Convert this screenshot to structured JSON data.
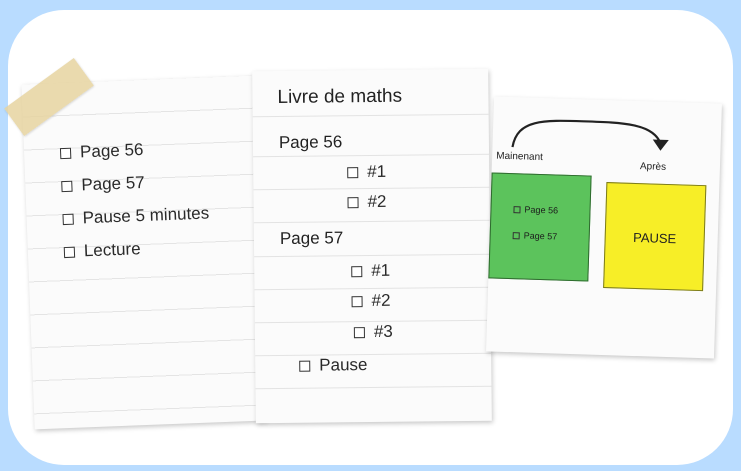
{
  "sheet_left": {
    "items": [
      "Page 56",
      "Page 57",
      "Pause 5 minutes",
      "Lecture"
    ]
  },
  "sheet_middle": {
    "title": "Livre de maths",
    "section1": "Page 56",
    "section1_items": [
      "#1",
      "#2"
    ],
    "section2": "Page 57",
    "section2_items": [
      "#1",
      "#2",
      "#3"
    ],
    "final_item": "Pause"
  },
  "sheet_right": {
    "label_now": "Mainenant",
    "label_after": "Après",
    "now_items": [
      "Page 56",
      "Page 57"
    ],
    "after_text": "PAUSE",
    "colors": {
      "now": "#5cc35c",
      "after": "#f7ee27"
    }
  }
}
